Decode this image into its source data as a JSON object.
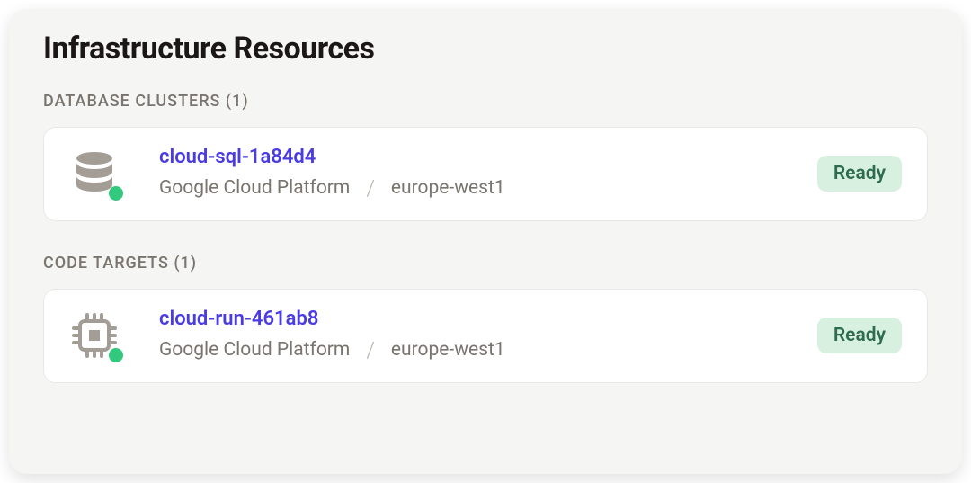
{
  "page_title": "Infrastructure Resources",
  "sections": {
    "database_clusters": {
      "header": "DATABASE CLUSTERS (1)",
      "item": {
        "name": "cloud-sql-1a84d4",
        "provider": "Google Cloud Platform",
        "region": "europe-west1",
        "status": "Ready",
        "status_color": "green"
      }
    },
    "code_targets": {
      "header": "CODE TARGETS (1)",
      "item": {
        "name": "cloud-run-461ab8",
        "provider": "Google Cloud Platform",
        "region": "europe-west1",
        "status": "Ready",
        "status_color": "green"
      }
    }
  },
  "separator": "/"
}
